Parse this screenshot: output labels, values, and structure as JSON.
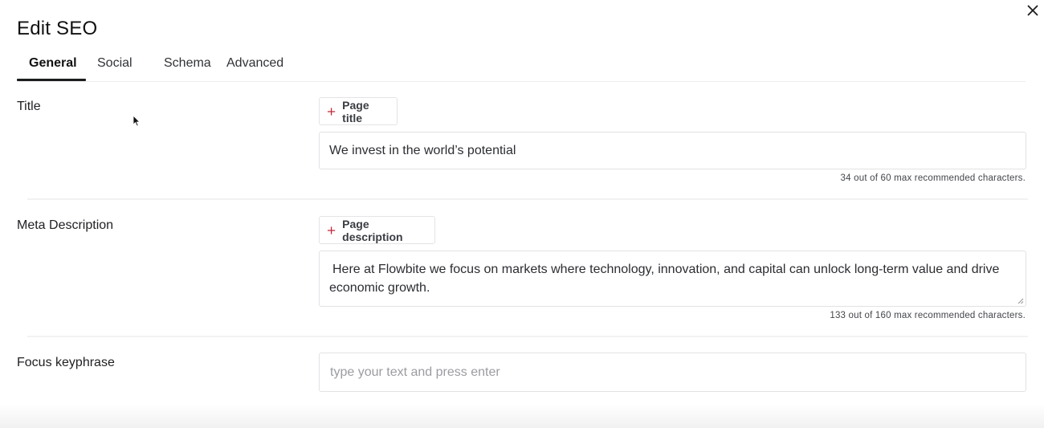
{
  "modal": {
    "title": "Edit SEO",
    "close_icon": "close-icon"
  },
  "tabs": [
    {
      "label": "General",
      "active": true
    },
    {
      "label": "Social",
      "active": false
    },
    {
      "label": "Schema",
      "active": false
    },
    {
      "label": "Advanced",
      "active": false
    }
  ],
  "title_section": {
    "label": "Title",
    "chip_label": "Page title",
    "chip_icon": "plus-icon",
    "value": "We invest in the world’s potential",
    "counter": "34 out of 60 max recommended characters."
  },
  "meta_section": {
    "label": "Meta Description",
    "chip_label": "Page description",
    "chip_icon": "plus-icon",
    "value": "Here at Flowbite we focus on markets where technology, innovation, and capital can unlock long-term value and drive economic growth.",
    "counter": "133 out of 160 max recommended characters."
  },
  "keyphrase_section": {
    "label": "Focus keyphrase",
    "placeholder": "type your text and press enter"
  },
  "colors": {
    "chip_plus": "#c0283a",
    "active_tab_underline": "#1b1c1e",
    "border": "#e2e2e5"
  }
}
